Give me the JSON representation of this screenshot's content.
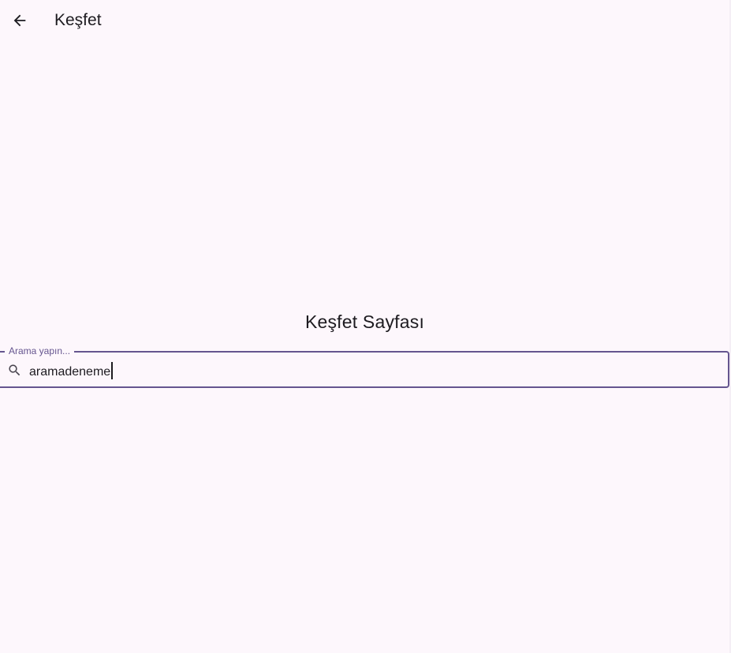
{
  "appbar": {
    "back_icon": "arrow-left-icon",
    "title": "Keşfet"
  },
  "main": {
    "heading": "Keşfet Sayfası"
  },
  "search": {
    "label": "Arama yapın...",
    "value": "aramadeneme",
    "icon": "search-icon"
  },
  "colors": {
    "background": "#fdf7fc",
    "text": "#1d1b20",
    "accent": "#65558f"
  }
}
